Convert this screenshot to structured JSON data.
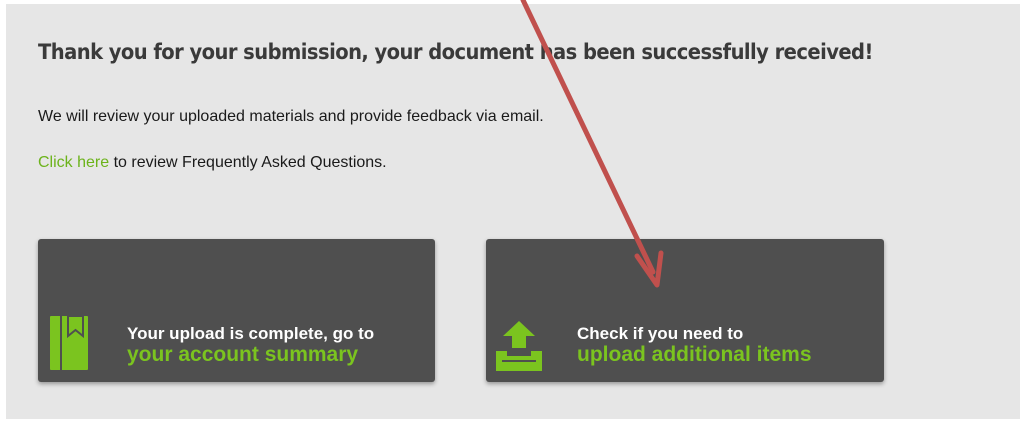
{
  "confirmation": {
    "heading": "Thank you for your submission, your document has been successfully received!",
    "message": "We will review your uploaded materials and provide feedback via email.",
    "faq_link": "Click here",
    "faq_text": " to review Frequently Asked Questions."
  },
  "cards": {
    "account": {
      "line1": "Your upload is complete, go to",
      "line2": "your account summary",
      "icon": "bookmark-icon"
    },
    "upload": {
      "line1": "Check if you need to",
      "line2": "upload additional items",
      "icon": "upload-tray-icon"
    }
  },
  "annotation": {
    "color": "#c0504d",
    "kind": "arrow"
  },
  "colors": {
    "accent": "#6cb31b",
    "card_bg": "#4f4f4f",
    "panel_bg": "#e6e6e6"
  }
}
